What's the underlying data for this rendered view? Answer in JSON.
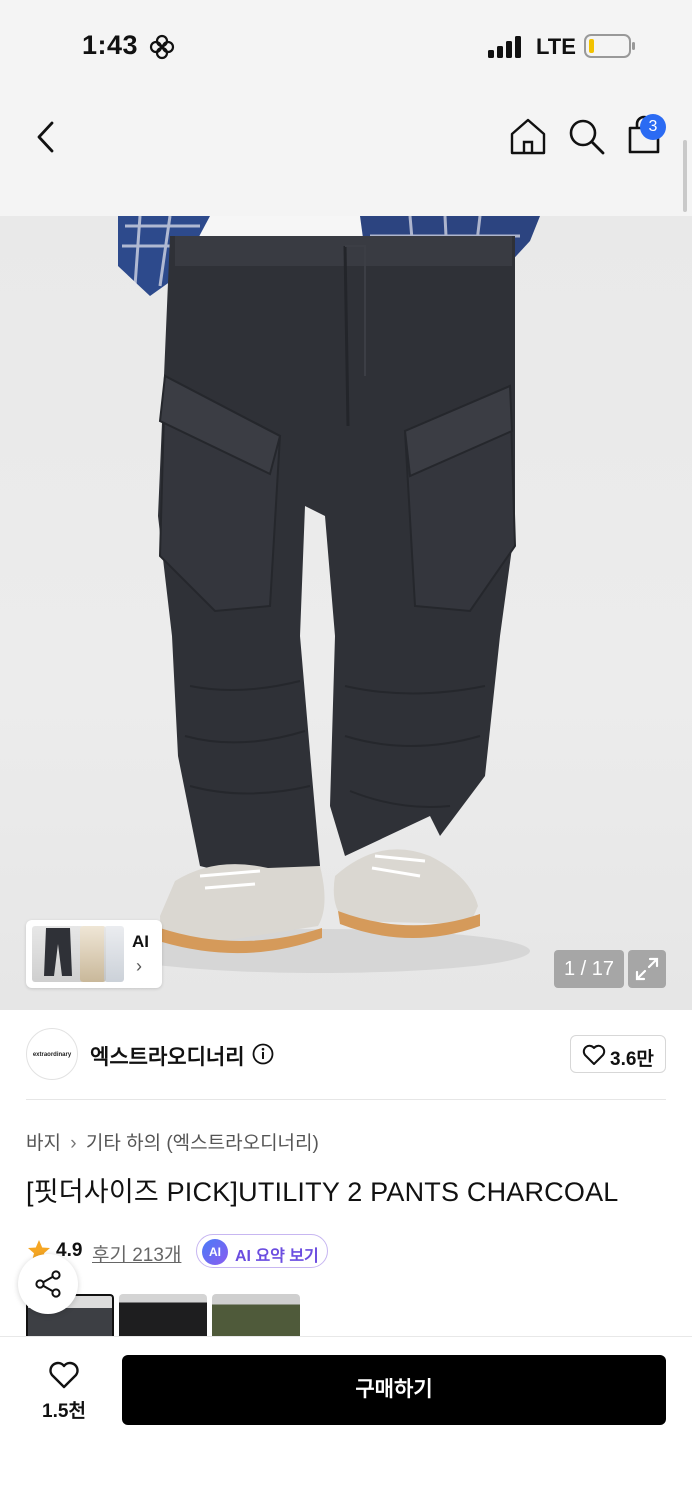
{
  "status_bar": {
    "time": "1:43",
    "network": "LTE"
  },
  "header": {
    "cart_count": "3"
  },
  "gallery": {
    "counter": "1 / 17",
    "thumb_ai_label": "AI",
    "thumb_chevron": "›"
  },
  "brand": {
    "logo_text": "extraordinary",
    "name": "엑스트라오디너리",
    "likes": "3.6만"
  },
  "breadcrumb": {
    "items": [
      "바지",
      "기타 하의 (엑스트라오디너리)"
    ],
    "separator": "›"
  },
  "product": {
    "title": "[핏더사이즈 PICK]UTILITY 2 PANTS CHARCOAL",
    "rating": "4.9",
    "reviews": "후기 213개",
    "ai_badge": "AI",
    "ai_summary": "AI 요약 보기"
  },
  "swatches": [
    {
      "color": "#3d3f44",
      "selected": true
    },
    {
      "color": "#1e1e1f",
      "selected": false
    },
    {
      "color": "#4f5a3a",
      "selected": false
    }
  ],
  "bottom_bar": {
    "wish_count": "1.5천",
    "buy_label": "구매하기"
  },
  "colors": {
    "accent_blue": "#2b6bf3",
    "star": "#f5a623",
    "ai_purple": "#6b4de0",
    "buy_button": "#000000"
  }
}
